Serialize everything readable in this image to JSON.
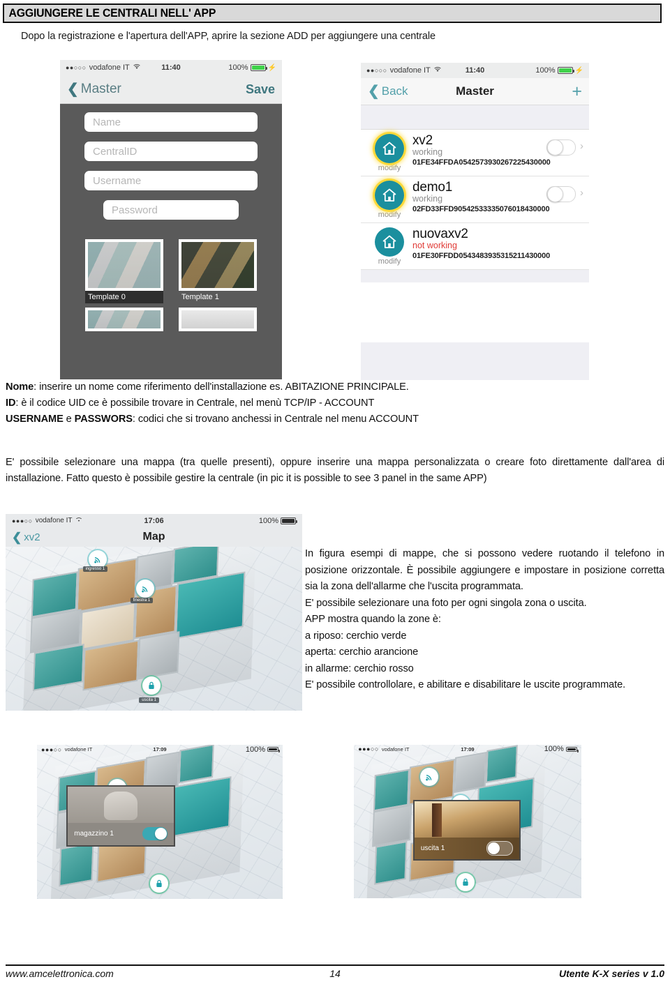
{
  "header": {
    "title": "AGGIUNGERE LE CENTRALI NELL' APP",
    "subtitle": "Dopo la registrazione e l'apertura dell'APP, aprire la sezione  ADD per aggiungere una centrale"
  },
  "phone_add": {
    "status": {
      "carrier": "vodafone IT",
      "dots": "●●○○○",
      "wifi": "wifi-icon",
      "time": "11:40",
      "battery_pct": "100%",
      "charging": "⚡"
    },
    "nav": {
      "back_label": "Master",
      "back_icon": "chevron-left-icon",
      "action_label": "Save"
    },
    "fields": [
      {
        "placeholder": "Name"
      },
      {
        "placeholder": "CentralID"
      },
      {
        "placeholder": "Username"
      },
      {
        "placeholder": "Password"
      }
    ],
    "templates": [
      {
        "label": "Template 0",
        "selected": true
      },
      {
        "label": "Template 1",
        "selected": false
      }
    ]
  },
  "phone_list": {
    "status": {
      "carrier": "vodafone IT",
      "dots": "●●○○○",
      "wifi": "wifi-icon",
      "time": "11:40",
      "battery_pct": "100%",
      "charging": "⚡"
    },
    "nav": {
      "back_label": "Back",
      "back_icon": "chevron-left-icon",
      "title": "Master",
      "add_label": "+"
    },
    "items": [
      {
        "name": "xv2",
        "status": "working",
        "uid": "01FE34FFDA0542573930267225430000",
        "modify_label": "modify",
        "glow": true,
        "has_toggle": true,
        "chevron": "›"
      },
      {
        "name": "demo1",
        "status": "working",
        "uid": "02FD33FFD90542533335076018430000",
        "modify_label": "modify",
        "glow": true,
        "has_toggle": true,
        "chevron": "›"
      },
      {
        "name": "nuovaxv2",
        "status": "not working",
        "uid": "01FE30FFDD0543483935315211430000",
        "modify_label": "modify",
        "glow": false,
        "has_toggle": false,
        "chevron": ""
      }
    ]
  },
  "body": {
    "nome_label": "Nome",
    "nome_text": ":  inserire un nome come riferimento dell'installazione es. ABITAZIONE PRINCIPALE.",
    "id_label": "ID",
    "id_text": ": è il codice UID ce è possibile trovare in Centrale, nel menù TCP/IP - ACCOUNT",
    "user_label": "USERNAME",
    "user_mid": " e ",
    "pass_label": "PASSWORS",
    "user_text": ": codici che si trovano anchessi in Centrale nel menu ACCOUNT",
    "paragraph2": "E' possibile selezionare una mappa (tra quelle presenti), oppure inserire una mappa personalizzata o creare foto direttamente dall'area di installazione. Fatto questo è possibile gestire la centrale (in pic it is possible to see 3 panel in the same APP)"
  },
  "map_shot": {
    "status": {
      "carrier": "vodafone IT",
      "dots": "●●●○○",
      "time": "17:06",
      "battery_pct": "100%"
    },
    "nav": {
      "back_label": "xv2",
      "back_icon": "chevron-left-icon",
      "title": "Map"
    },
    "sensors": [
      {
        "icon": "motion-sensor-icon",
        "label": "ingresso 1"
      },
      {
        "icon": "motion-sensor-icon",
        "label": "finestra 1"
      },
      {
        "icon": "output-lock-icon",
        "label": "uscita 1"
      }
    ]
  },
  "right_text": {
    "p1": "In figura esempi di mappe, che si possono vedere ruotando il telefono in posizione orizzontale. È possibile aggiungere e impostare in posizione corretta sia la zona dell'allarme che l'uscita programmata.",
    "p2": "E' possibile selezionare una foto per ogni singola zona o uscita.",
    "p3": "APP mostra quando la zone è:",
    "p4": "a riposo: cerchio verde",
    "p5": "aperta: cerchio arancione",
    "p6": "in allarme: cerchio rosso",
    "p7": "E' possibile controllolare, e abilitare e disabilitare le uscite programmate."
  },
  "shot_bottom_left": {
    "status": {
      "carrier": "vodafone IT",
      "dots": "●●●○○",
      "time": "17:09",
      "battery_pct": "100%"
    },
    "popup": {
      "label": "magazzino 1",
      "toggle_state": "on"
    }
  },
  "shot_bottom_right": {
    "status": {
      "carrier": "vodafone IT",
      "dots": "●●●○○",
      "time": "17:09",
      "battery_pct": "100%"
    },
    "popup": {
      "label": "uscita 1",
      "toggle_state": "off"
    }
  },
  "footer": {
    "site": "www.amcelettronica.com",
    "page": "14",
    "doc": "Utente K-X series v 1.0"
  },
  "colors": {
    "accent_teal": "#1b8f9e",
    "glow_yellow": "#fdd93a",
    "status_bad_red": "#e03b36",
    "header_bg": "#d9d9d9"
  }
}
